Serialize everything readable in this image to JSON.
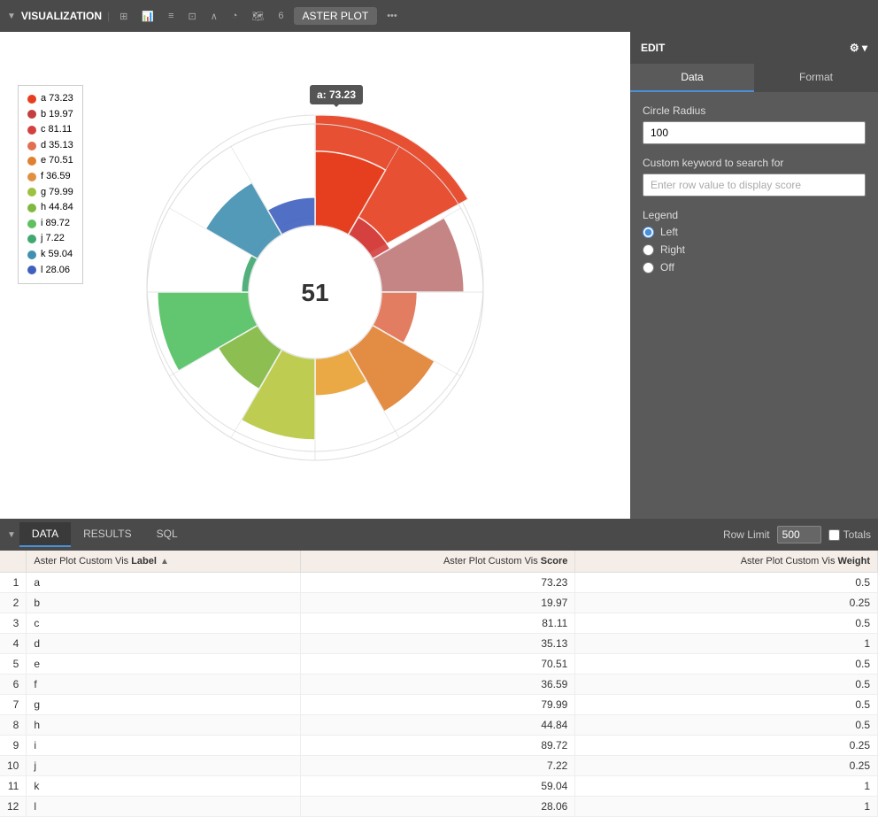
{
  "toolbar": {
    "title": "VISUALIZATION",
    "chart_type": "ASTER PLOT",
    "edit_label": "EDIT"
  },
  "edit_panel": {
    "tabs": [
      "Data",
      "Format"
    ],
    "active_tab": "Data",
    "circle_radius_label": "Circle Radius",
    "circle_radius_value": "100",
    "custom_keyword_label": "Custom keyword to search for",
    "custom_keyword_placeholder": "Enter row value to display score",
    "legend_label": "Legend",
    "legend_options": [
      "Left",
      "Right",
      "Off"
    ],
    "legend_selected": "Left"
  },
  "chart": {
    "center_value": "51",
    "tooltip": "a: 73.23"
  },
  "legend": {
    "items": [
      {
        "label": "a 73.23",
        "color": "#e63e1e"
      },
      {
        "label": "b 19.97",
        "color": "#d44040"
      },
      {
        "label": "c 81.11",
        "color": "#c44040"
      },
      {
        "label": "d 35.13",
        "color": "#e07050"
      },
      {
        "label": "e 70.51",
        "color": "#e08030"
      },
      {
        "label": "f 36.59",
        "color": "#e09040"
      },
      {
        "label": "g 79.99",
        "color": "#a0c040"
      },
      {
        "label": "h 44.84",
        "color": "#80b840"
      },
      {
        "label": "i 89.72",
        "color": "#60c060"
      },
      {
        "label": "j 7.22",
        "color": "#40a870"
      },
      {
        "label": "k 59.04",
        "color": "#4090b0"
      },
      {
        "label": "l 28.06",
        "color": "#4060c0"
      }
    ]
  },
  "data_section": {
    "tabs": [
      "DATA",
      "RESULTS",
      "SQL"
    ],
    "active_tab": "DATA",
    "row_limit_label": "Row Limit",
    "row_limit_value": "500",
    "totals_label": "Totals",
    "columns": [
      {
        "name": "col-label",
        "header": "Aster Plot Custom Vis Label",
        "sortable": true,
        "sort_dir": "asc"
      },
      {
        "name": "col-score",
        "header": "Aster Plot Custom Vis Score",
        "sortable": false
      },
      {
        "name": "col-weight",
        "header": "Aster Plot Custom Vis Weight",
        "sortable": false
      }
    ],
    "rows": [
      {
        "num": 1,
        "label": "a",
        "score": "73.23",
        "weight": "0.5"
      },
      {
        "num": 2,
        "label": "b",
        "score": "19.97",
        "weight": "0.25"
      },
      {
        "num": 3,
        "label": "c",
        "score": "81.11",
        "weight": "0.5"
      },
      {
        "num": 4,
        "label": "d",
        "score": "35.13",
        "weight": "1"
      },
      {
        "num": 5,
        "label": "e",
        "score": "70.51",
        "weight": "0.5"
      },
      {
        "num": 6,
        "label": "f",
        "score": "36.59",
        "weight": "0.5"
      },
      {
        "num": 7,
        "label": "g",
        "score": "79.99",
        "weight": "0.5"
      },
      {
        "num": 8,
        "label": "h",
        "score": "44.84",
        "weight": "0.5"
      },
      {
        "num": 9,
        "label": "i",
        "score": "89.72",
        "weight": "0.25"
      },
      {
        "num": 10,
        "label": "j",
        "score": "7.22",
        "weight": "0.25"
      },
      {
        "num": 11,
        "label": "k",
        "score": "59.04",
        "weight": "1"
      },
      {
        "num": 12,
        "label": "l",
        "score": "28.06",
        "weight": "1"
      }
    ]
  }
}
